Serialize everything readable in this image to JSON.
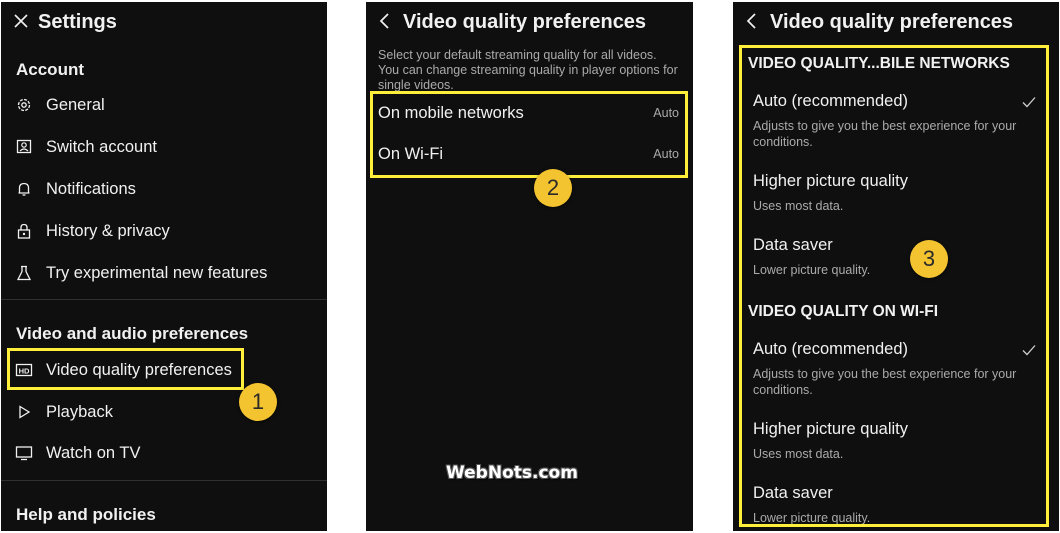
{
  "panel1": {
    "title": "Settings",
    "account_header": "Account",
    "account_items": [
      {
        "label": "General",
        "icon": "gear-icon"
      },
      {
        "label": "Switch account",
        "icon": "switch-account-icon"
      },
      {
        "label": "Notifications",
        "icon": "bell-icon"
      },
      {
        "label": "History & privacy",
        "icon": "lock-icon"
      },
      {
        "label": "Try experimental new features",
        "icon": "flask-icon"
      }
    ],
    "video_header": "Video and audio preferences",
    "video_items": [
      {
        "label": "Video quality preferences",
        "icon": "hd-icon"
      },
      {
        "label": "Playback",
        "icon": "play-icon"
      },
      {
        "label": "Watch on TV",
        "icon": "tv-icon"
      }
    ],
    "help_header": "Help and policies",
    "step_badge": "1"
  },
  "panel2": {
    "title": "Video quality preferences",
    "description": "Select your default streaming quality for all videos. You can change streaming quality in player options for single videos.",
    "rows": [
      {
        "label": "On mobile networks",
        "value": "Auto"
      },
      {
        "label": "On Wi-Fi",
        "value": "Auto"
      }
    ],
    "step_badge": "2"
  },
  "panel3": {
    "title": "Video quality preferences",
    "mobile_header": "VIDEO QUALITY...BILE NETWORKS",
    "mobile_options": [
      {
        "title": "Auto (recommended)",
        "subtitle": "Adjusts to give you the best experience for your conditions.",
        "selected": true
      },
      {
        "title": "Higher picture quality",
        "subtitle": "Uses most data.",
        "selected": false
      },
      {
        "title": "Data saver",
        "subtitle": "Lower picture quality.",
        "selected": false
      }
    ],
    "wifi_header": "VIDEO QUALITY ON WI-FI",
    "wifi_options": [
      {
        "title": "Auto (recommended)",
        "subtitle": "Adjusts to give you the best experience for your conditions.",
        "selected": true
      },
      {
        "title": "Higher picture quality",
        "subtitle": "Uses most data.",
        "selected": false
      },
      {
        "title": "Data saver",
        "subtitle": "Lower picture quality.",
        "selected": false
      }
    ],
    "step_badge": "3"
  },
  "watermark": "WebNots.com",
  "colors": {
    "background": "#0f0f0f",
    "highlight": "#ffef3a",
    "badge": "#f4c430",
    "text": "#f1f1f1",
    "secondary_text": "#aaaaaa"
  }
}
